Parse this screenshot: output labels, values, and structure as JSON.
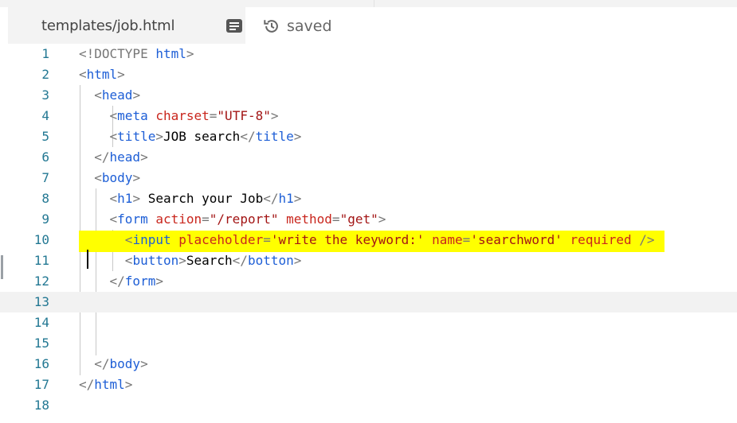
{
  "tab": {
    "filename": "templates/job.html",
    "doc_icon": "document-icon"
  },
  "status": {
    "label": "saved",
    "icon": "history-icon"
  },
  "editor": {
    "current_line": 13,
    "lines": [
      {
        "num": "1",
        "tokens": [
          {
            "t": "p",
            "v": "<!DOCTYPE "
          },
          {
            "t": "t",
            "v": "html"
          },
          {
            "t": "p",
            "v": ">"
          }
        ]
      },
      {
        "num": "2",
        "tokens": [
          {
            "t": "p",
            "v": "<"
          },
          {
            "t": "t",
            "v": "html"
          },
          {
            "t": "p",
            "v": ">"
          }
        ]
      },
      {
        "num": "3",
        "tokens": [
          {
            "t": "x",
            "v": "  "
          },
          {
            "t": "p",
            "v": "<"
          },
          {
            "t": "t",
            "v": "head"
          },
          {
            "t": "p",
            "v": ">"
          }
        ]
      },
      {
        "num": "4",
        "tokens": [
          {
            "t": "x",
            "v": "    "
          },
          {
            "t": "p",
            "v": "<"
          },
          {
            "t": "t",
            "v": "meta "
          },
          {
            "t": "a",
            "v": "charset"
          },
          {
            "t": "p",
            "v": "="
          },
          {
            "t": "s",
            "v": "\"UTF-8\""
          },
          {
            "t": "p",
            "v": ">"
          }
        ]
      },
      {
        "num": "5",
        "tokens": [
          {
            "t": "x",
            "v": "    "
          },
          {
            "t": "p",
            "v": "<"
          },
          {
            "t": "t",
            "v": "title"
          },
          {
            "t": "p",
            "v": ">"
          },
          {
            "t": "x",
            "v": "JOB search"
          },
          {
            "t": "p",
            "v": "</"
          },
          {
            "t": "t",
            "v": "title"
          },
          {
            "t": "p",
            "v": ">"
          }
        ]
      },
      {
        "num": "6",
        "tokens": [
          {
            "t": "x",
            "v": "  "
          },
          {
            "t": "p",
            "v": "</"
          },
          {
            "t": "t",
            "v": "head"
          },
          {
            "t": "p",
            "v": ">"
          }
        ]
      },
      {
        "num": "7",
        "tokens": [
          {
            "t": "x",
            "v": "  "
          },
          {
            "t": "p",
            "v": "<"
          },
          {
            "t": "t",
            "v": "body"
          },
          {
            "t": "p",
            "v": ">"
          }
        ]
      },
      {
        "num": "8",
        "tokens": [
          {
            "t": "x",
            "v": "    "
          },
          {
            "t": "p",
            "v": "<"
          },
          {
            "t": "t",
            "v": "h1"
          },
          {
            "t": "p",
            "v": ">"
          },
          {
            "t": "x",
            "v": " Search your Job"
          },
          {
            "t": "p",
            "v": "</"
          },
          {
            "t": "t",
            "v": "h1"
          },
          {
            "t": "p",
            "v": ">"
          }
        ]
      },
      {
        "num": "9",
        "tokens": [
          {
            "t": "x",
            "v": "    "
          },
          {
            "t": "p",
            "v": "<"
          },
          {
            "t": "t",
            "v": "form "
          },
          {
            "t": "a",
            "v": "action"
          },
          {
            "t": "p",
            "v": "="
          },
          {
            "t": "s",
            "v": "\"/report\""
          },
          {
            "t": "x",
            "v": " "
          },
          {
            "t": "a",
            "v": "method"
          },
          {
            "t": "p",
            "v": "="
          },
          {
            "t": "s",
            "v": "\"get\""
          },
          {
            "t": "p",
            "v": ">"
          }
        ]
      },
      {
        "num": "10",
        "highlight": true,
        "tokens": [
          {
            "t": "x",
            "v": "      "
          },
          {
            "t": "p",
            "v": "<"
          },
          {
            "t": "t",
            "v": "input "
          },
          {
            "t": "a",
            "v": "placeholder"
          },
          {
            "t": "p",
            "v": "="
          },
          {
            "t": "s",
            "v": "'write the keyword:'"
          },
          {
            "t": "x",
            "v": " "
          },
          {
            "t": "a",
            "v": "name"
          },
          {
            "t": "p",
            "v": "="
          },
          {
            "t": "s",
            "v": "'searchword'"
          },
          {
            "t": "x",
            "v": " "
          },
          {
            "t": "a",
            "v": "required"
          },
          {
            "t": "x",
            "v": " "
          },
          {
            "t": "p",
            "v": "/>"
          }
        ]
      },
      {
        "num": "11",
        "tokens": [
          {
            "t": "x",
            "v": "      "
          },
          {
            "t": "p",
            "v": "<"
          },
          {
            "t": "t",
            "v": "button"
          },
          {
            "t": "p",
            "v": ">"
          },
          {
            "t": "x",
            "v": "Search"
          },
          {
            "t": "p",
            "v": "</"
          },
          {
            "t": "t",
            "v": "botton"
          },
          {
            "t": "p",
            "v": ">"
          }
        ]
      },
      {
        "num": "12",
        "tokens": [
          {
            "t": "x",
            "v": "    "
          },
          {
            "t": "p",
            "v": "</"
          },
          {
            "t": "t",
            "v": "form"
          },
          {
            "t": "p",
            "v": ">"
          }
        ]
      },
      {
        "num": "13",
        "tokens": []
      },
      {
        "num": "14",
        "tokens": []
      },
      {
        "num": "15",
        "tokens": []
      },
      {
        "num": "16",
        "tokens": [
          {
            "t": "x",
            "v": "  "
          },
          {
            "t": "p",
            "v": "</"
          },
          {
            "t": "t",
            "v": "body"
          },
          {
            "t": "p",
            "v": ">"
          }
        ]
      },
      {
        "num": "17",
        "tokens": [
          {
            "t": "p",
            "v": "</"
          },
          {
            "t": "t",
            "v": "html"
          },
          {
            "t": "p",
            "v": ">"
          }
        ]
      },
      {
        "num": "18",
        "tokens": []
      }
    ]
  }
}
